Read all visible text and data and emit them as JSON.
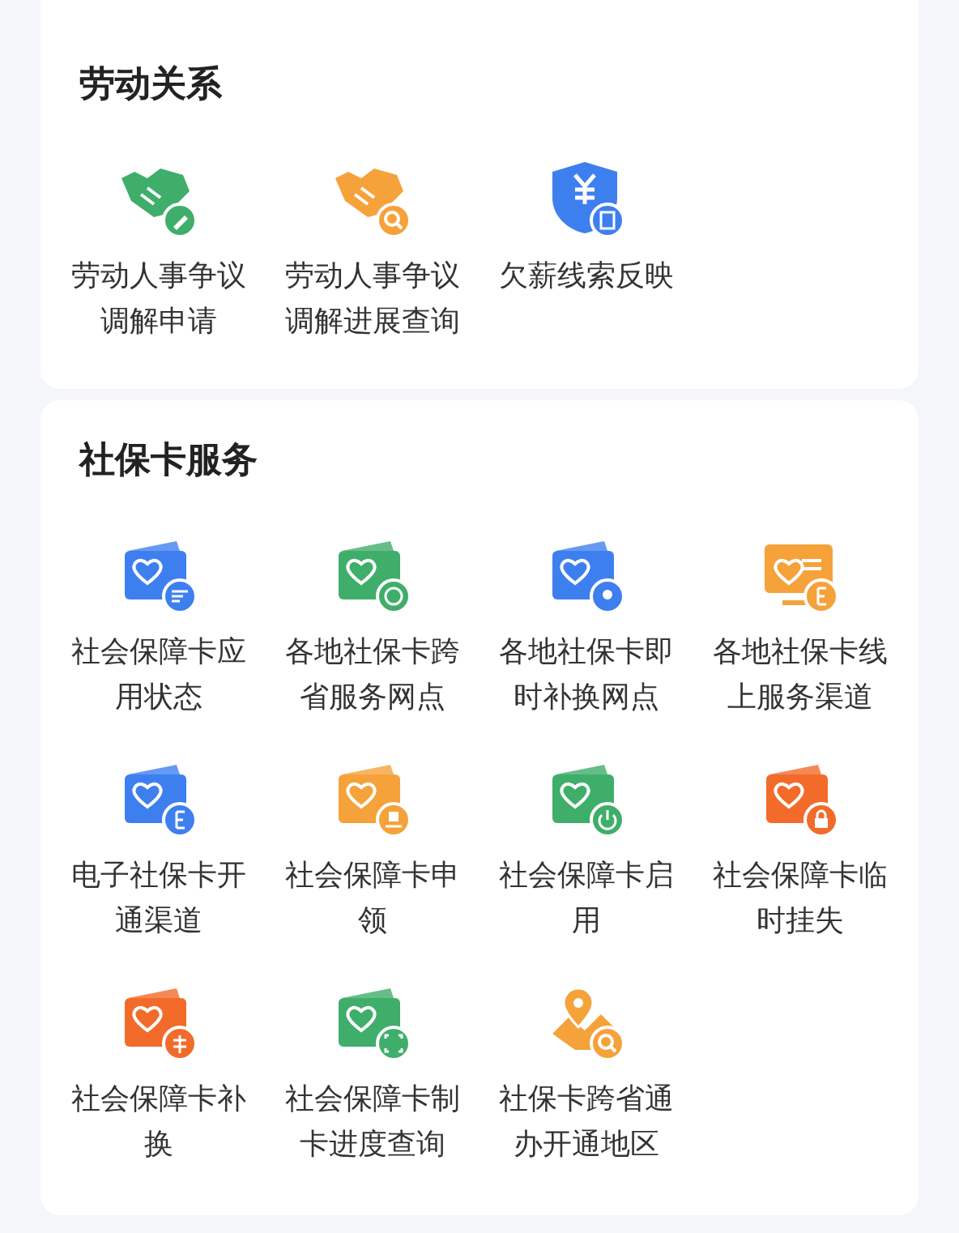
{
  "sections": [
    {
      "title": "劳动关系",
      "items": [
        {
          "label": "劳动人事争议调解申请",
          "kind": "handshake_pencil",
          "color": "#3fae6a"
        },
        {
          "label": "劳动人事争议调解进展查询",
          "kind": "handshake_search",
          "color": "#f5a23a"
        },
        {
          "label": "欠薪线索反映",
          "kind": "shield_doc",
          "color": "#3e7ff0"
        }
      ]
    },
    {
      "title": "社保卡服务",
      "items": [
        {
          "label": "社会保障卡应用状态",
          "kind": "card_list",
          "color": "#3e7ff0"
        },
        {
          "label": "各地社保卡跨省服务网点",
          "kind": "card_globe",
          "color": "#3fae6a"
        },
        {
          "label": "各地社保卡即时补换网点",
          "kind": "card_pin",
          "color": "#3e7ff0"
        },
        {
          "label": "各地社保卡线上服务渠道",
          "kind": "monitor_e",
          "color": "#f5a23a"
        },
        {
          "label": "电子社保卡开通渠道",
          "kind": "card_e",
          "color": "#3e7ff0"
        },
        {
          "label": "社会保障卡申领",
          "kind": "card_hand",
          "color": "#f5a23a"
        },
        {
          "label": "社会保障卡启用",
          "kind": "card_power",
          "color": "#3fae6a"
        },
        {
          "label": "社会保障卡临时挂失",
          "kind": "card_lock",
          "color": "#f26b2a"
        },
        {
          "label": "社会保障卡补换",
          "kind": "card_swap",
          "color": "#f26b2a"
        },
        {
          "label": "社会保障卡制卡进度查询",
          "kind": "card_scan",
          "color": "#3fae6a"
        },
        {
          "label": "社保卡跨省通办开通地区",
          "kind": "map_search",
          "color": "#f5a23a"
        }
      ]
    }
  ]
}
